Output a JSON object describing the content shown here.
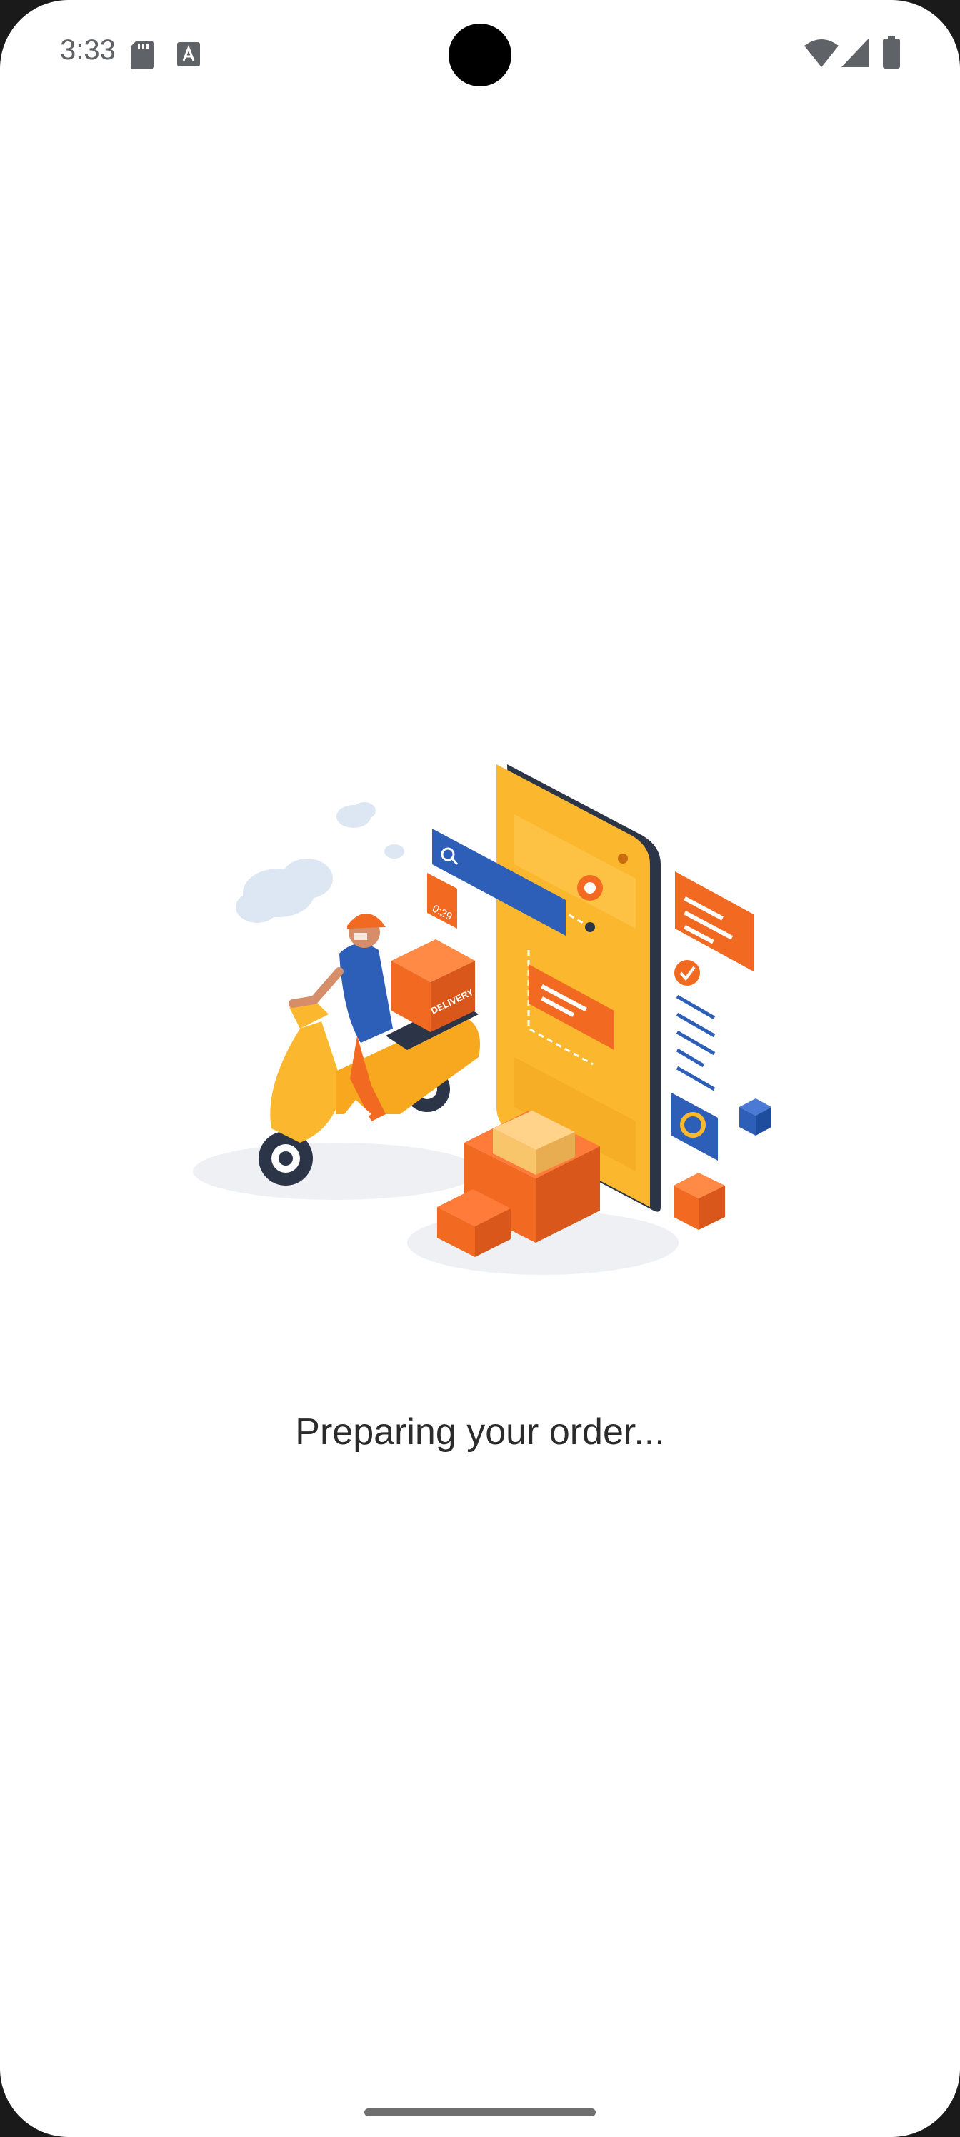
{
  "status_bar": {
    "time": "3:33",
    "left_icons": [
      "sd-card-icon",
      "keyboard-a-icon"
    ],
    "right_icons": [
      "wifi-icon",
      "cellular-signal-icon",
      "battery-icon"
    ]
  },
  "illustration": {
    "badge_label": "DELIVERY",
    "timer_text": "0:29",
    "colors": {
      "orange": "#f26a21",
      "yellow": "#fbb82e",
      "blue": "#2d5fb8",
      "dark": "#2c3447"
    }
  },
  "message": "Preparing your order..."
}
